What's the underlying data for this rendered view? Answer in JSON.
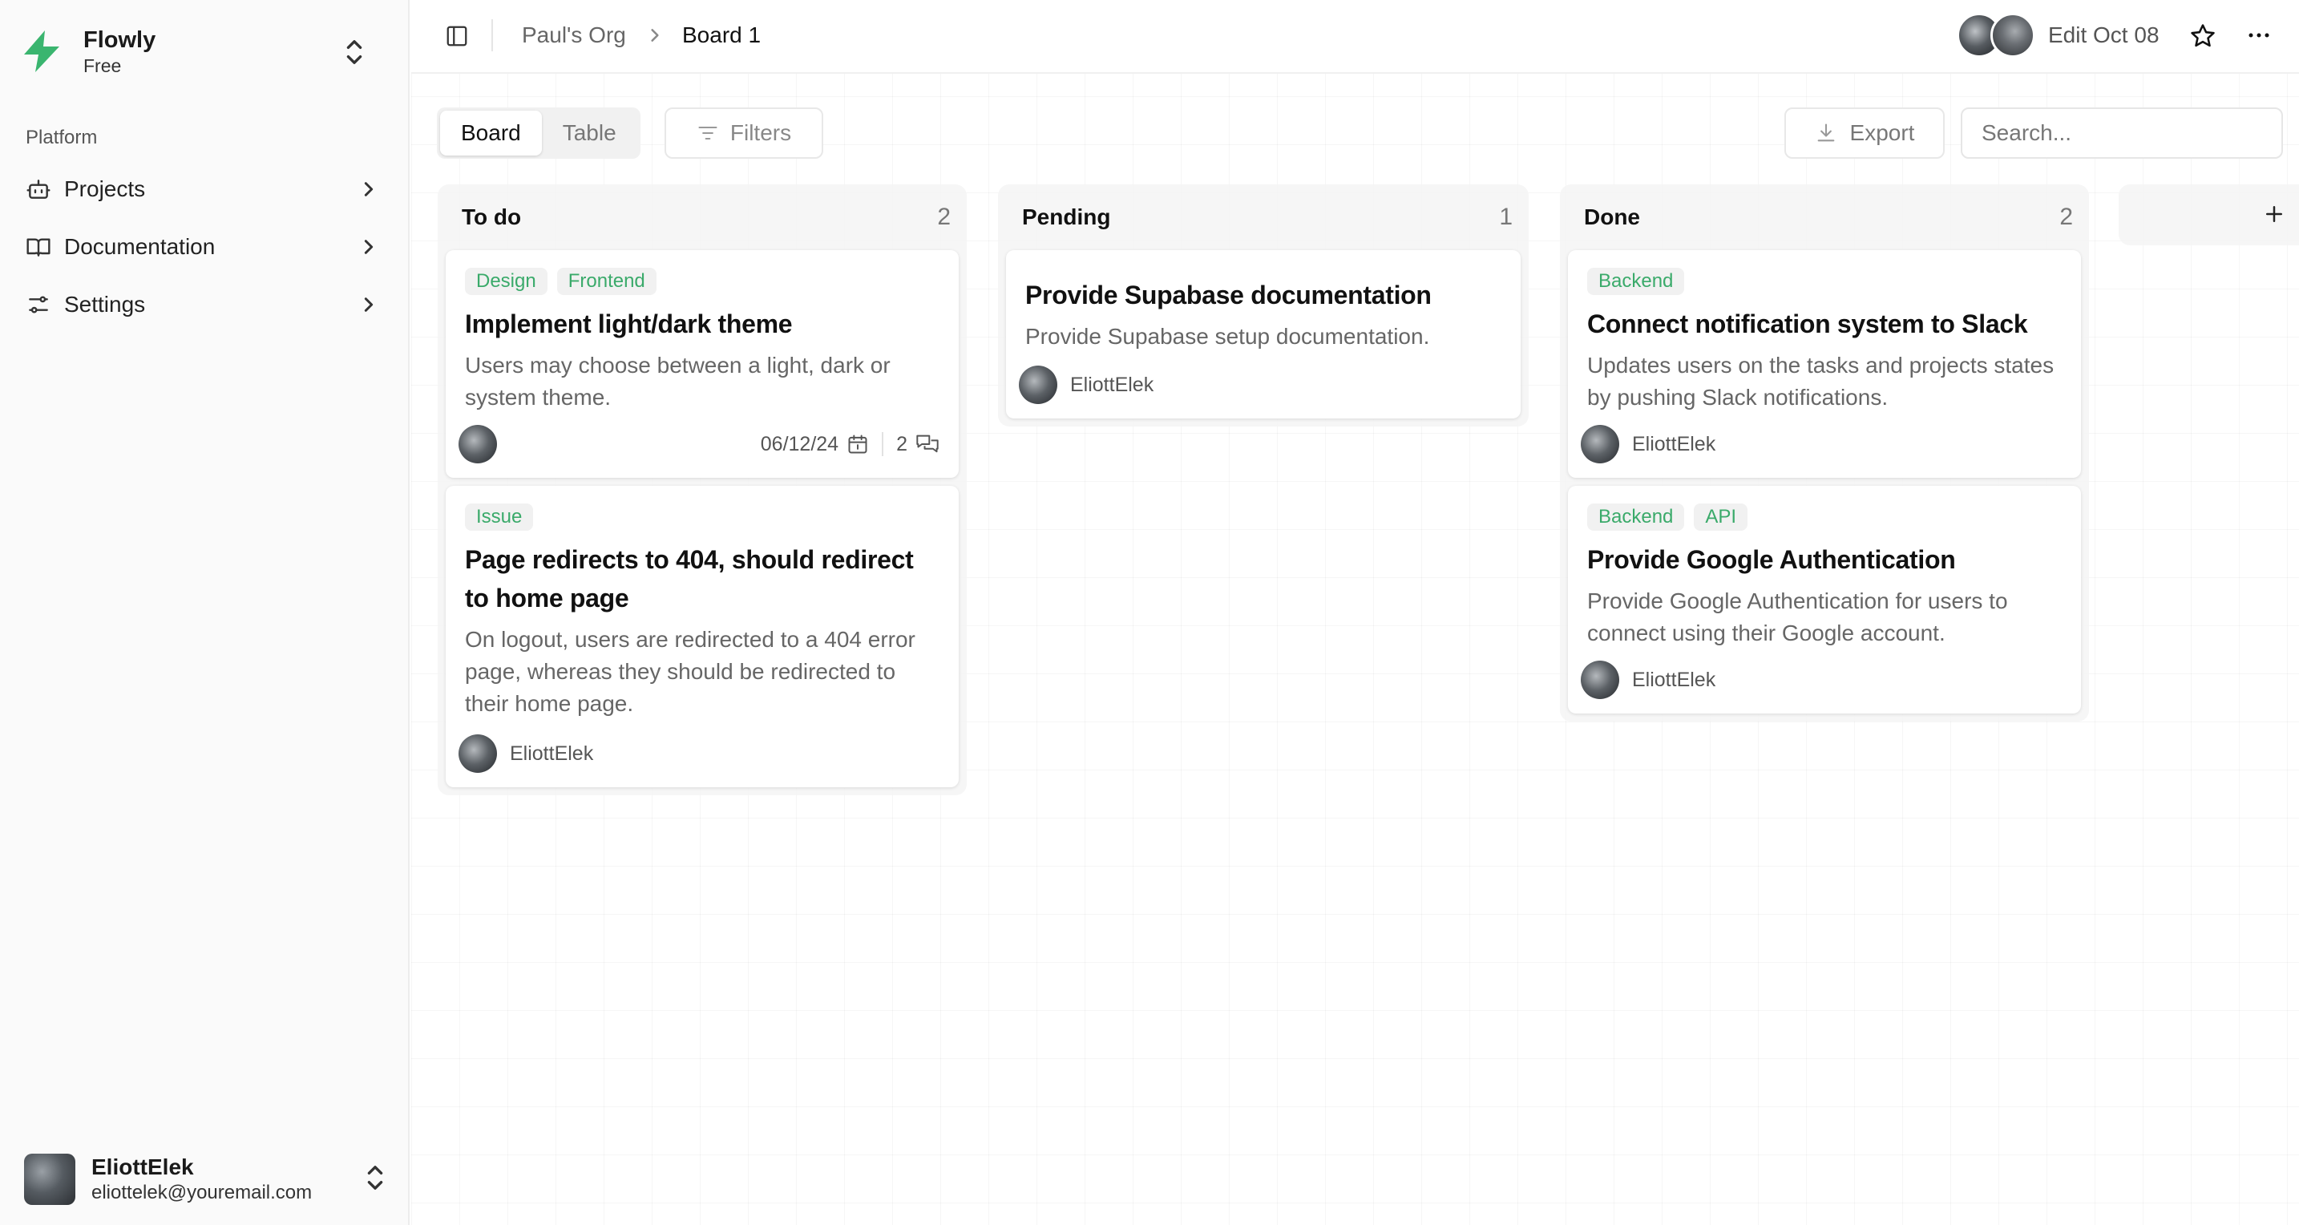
{
  "app": {
    "name": "Flowly",
    "plan": "Free",
    "accent": "#3ab56f"
  },
  "sidebar": {
    "section_label": "Platform",
    "items": [
      {
        "label": "Projects",
        "icon": "bot-icon"
      },
      {
        "label": "Documentation",
        "icon": "book-icon"
      },
      {
        "label": "Settings",
        "icon": "sliders-icon"
      }
    ]
  },
  "user": {
    "name": "EliottElek",
    "email": "eliottelek@youremail.com"
  },
  "header": {
    "breadcrumb_org": "Paul's Org",
    "breadcrumb_board": "Board 1",
    "edit_date": "Edit Oct 08"
  },
  "toolbar": {
    "view_board": "Board",
    "view_table": "Table",
    "filters_label": "Filters",
    "export_label": "Export",
    "search_placeholder": "Search..."
  },
  "columns": [
    {
      "title": "To do",
      "count": "2",
      "cards": [
        {
          "tags": [
            "Design",
            "Frontend"
          ],
          "title": "Implement light/dark theme",
          "description": "Users may choose between a light, dark or system theme.",
          "assignee": "",
          "date": "06/12/24",
          "comments": "2"
        },
        {
          "tags": [
            "Issue"
          ],
          "title": "Page redirects to 404, should redirect to home page",
          "description": "On logout, users are redirected to a 404 error page, whereas they should be redirected to their home page.",
          "assignee": "EliottElek"
        }
      ]
    },
    {
      "title": "Pending",
      "count": "1",
      "cards": [
        {
          "tags": [],
          "title": "Provide Supabase documentation",
          "description": "Provide Supabase setup documentation.",
          "assignee": "EliottElek"
        }
      ]
    },
    {
      "title": "Done",
      "count": "2",
      "cards": [
        {
          "tags": [
            "Backend"
          ],
          "title": "Connect notification system to Slack",
          "description": "Updates users on the tasks and projects states by pushing Slack notifications.",
          "assignee": "EliottElek"
        },
        {
          "tags": [
            "Backend",
            "API"
          ],
          "title": "Provide Google Authentication",
          "description": "Provide Google Authentication for users to connect using their Google account.",
          "assignee": "EliottElek"
        }
      ]
    }
  ]
}
